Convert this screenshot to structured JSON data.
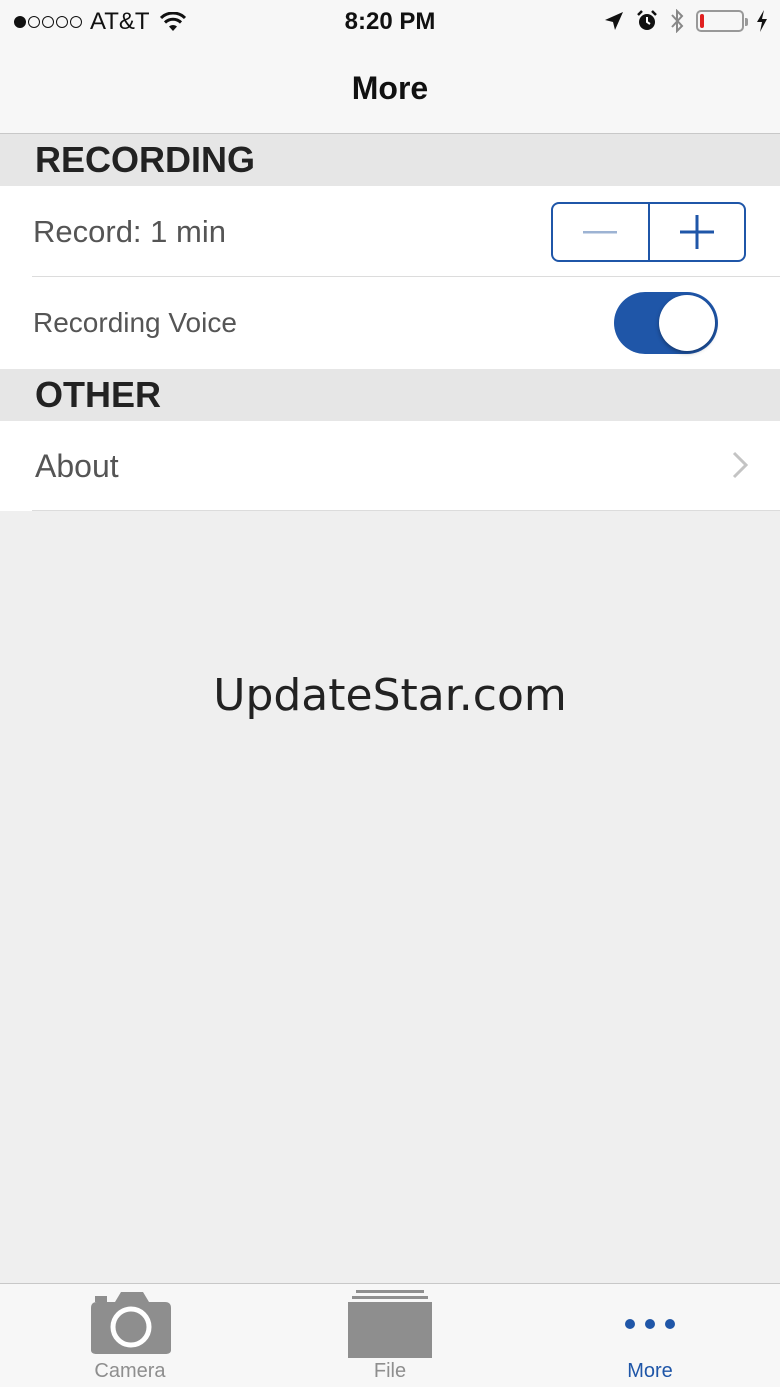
{
  "status_bar": {
    "carrier": "AT&T",
    "time": "8:20 PM",
    "signal_bars": 1,
    "signal_total": 5,
    "battery_level": 0.1,
    "battery_color": "#e02020"
  },
  "nav": {
    "title": "More"
  },
  "sections": {
    "recording": {
      "header": "RECORDING",
      "record_label": "Record: 1 min",
      "voice_label": "Recording Voice",
      "voice_enabled": true
    },
    "other": {
      "header": "OTHER",
      "about_label": "About"
    }
  },
  "watermark": "UpdateStar.com",
  "tabs": [
    {
      "label": "Camera",
      "icon": "camera-icon",
      "active": false
    },
    {
      "label": "File",
      "icon": "file-icon",
      "active": false
    },
    {
      "label": "More",
      "icon": "more-dots-icon",
      "active": true
    }
  ],
  "colors": {
    "accent": "#1f56a8",
    "inactive_tab": "#8e8e8e",
    "section_bg": "#e6e6e6",
    "page_bg": "#efefef"
  }
}
